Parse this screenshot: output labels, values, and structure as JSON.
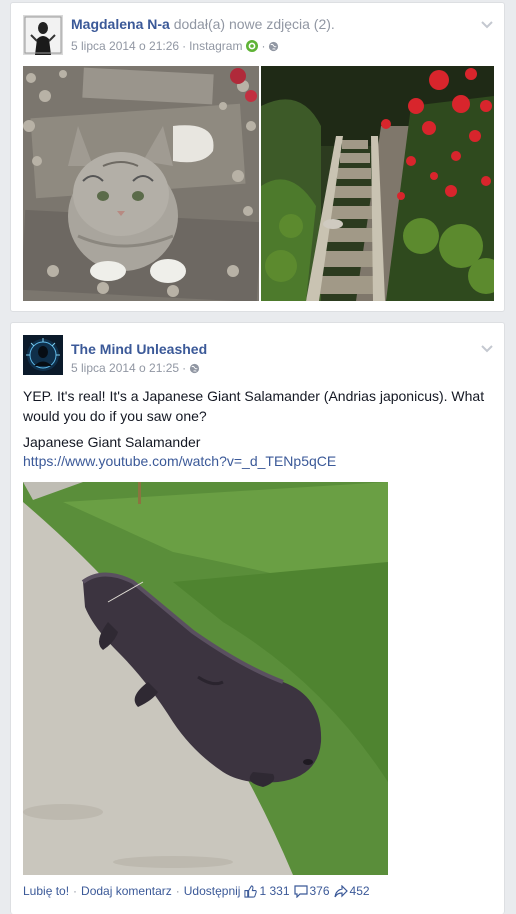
{
  "post1": {
    "author": "Magdalena N-a",
    "action": "dodał(a) nowe zdjęcia (2).",
    "date": "5 lipca 2014 o 21:26",
    "source": "Instagram",
    "images": [
      "photo-cat-on-stone-path",
      "photo-garden-path-red-flowers"
    ]
  },
  "post2": {
    "author": "The Mind Unleashed",
    "date": "5 lipca 2014 o 21:25",
    "text": "YEP. It's real! It's a Japanese Giant Salamander (Andrias japonicus). What would you do if you saw one?",
    "link_title": "Japanese Giant Salamander",
    "link_url": "https://www.youtube.com/watch?v=_d_TENp5qCE",
    "image": "photo-giant-salamander-on-grass",
    "footer": {
      "like": "Lubię to!",
      "comment": "Dodaj komentarz",
      "share": "Udostępnij",
      "likes_count": "1 331",
      "comments_count": "376",
      "shares_count": "452"
    }
  },
  "colors": {
    "link": "#3b5998",
    "meta": "#9197a3",
    "background": "#e9ebee",
    "instagram_badge": "#5fb336"
  },
  "icons": [
    "chevron-down-icon",
    "instagram-icon",
    "globe-icon",
    "like-icon",
    "comment-icon",
    "share-icon"
  ]
}
